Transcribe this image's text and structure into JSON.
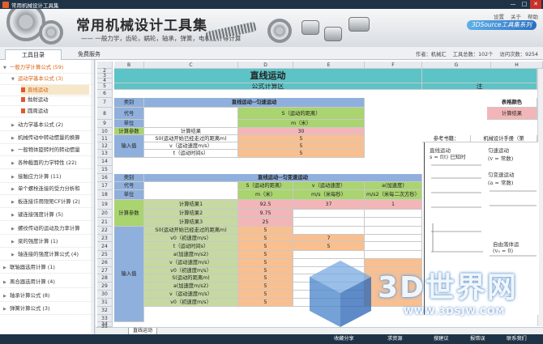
{
  "window": {
    "title": "常用机械设计工具集",
    "minimize": "—",
    "maximize": "□",
    "close": "✕"
  },
  "banner": {
    "title": "常用机械设计工具集",
    "subtitle": "—— 一般力学，齿轮，蜗轮，轴承，弹簧，电机设计等计算",
    "brand": "3DSource工具集系列",
    "top_actions": [
      "设置",
      "关于",
      "帮助"
    ]
  },
  "tabs": [
    {
      "label": "工具目录",
      "active": true
    },
    {
      "label": "免费服务",
      "active": false
    }
  ],
  "stats": {
    "author": "作者：机械汇",
    "total": "工具总数：102个",
    "visits": "访问次数：9254"
  },
  "sidebar": {
    "items": [
      {
        "label": "一般力学计算公式 (59)",
        "level": 0,
        "expanded": true,
        "orange": true
      },
      {
        "label": "运动学基本公式 (3)",
        "level": 1,
        "expanded": true,
        "orange": true
      },
      {
        "label": "直线运动",
        "level": 2,
        "doc": true,
        "selected": true,
        "orange": true
      },
      {
        "label": "抛射运动",
        "level": 2,
        "doc": true
      },
      {
        "label": "圆周运动",
        "level": 2,
        "doc": true
      },
      {
        "label": "动力学基本公式 (2)",
        "level": 1
      },
      {
        "label": "机械传动中转动惯量的换算",
        "level": 1
      },
      {
        "label": "一般物体旋转时的转动惯量",
        "level": 1
      },
      {
        "label": "各种截面的力学特性 (22)",
        "level": 1
      },
      {
        "label": "接触应力计算 (11)",
        "level": 1
      },
      {
        "label": "单个螺栓连接的受力分析和",
        "level": 1
      },
      {
        "label": "板连接许用限矩CF计算 (2)",
        "level": 1
      },
      {
        "label": "键连接强度计算 (5)",
        "level": 1
      },
      {
        "label": "螺纹传动的运动及力率计算",
        "level": 1
      },
      {
        "label": "梁的强度计算 (1)",
        "level": 1
      },
      {
        "label": "轴连接的强度计算公式 (4)",
        "level": 1
      },
      {
        "label": "联轴器选用计算 (1)",
        "level": 0
      },
      {
        "label": "离合器选用计算 (4)",
        "level": 0
      },
      {
        "label": "轴承计算公式 (8)",
        "level": 0
      },
      {
        "label": "弹簧计算公式 (3)",
        "level": 0
      }
    ]
  },
  "sheet": {
    "columns": [
      "B",
      "C",
      "D",
      "E",
      "F",
      "G",
      "H",
      "I"
    ],
    "rows": [
      "2",
      "3",
      "4",
      "5",
      "6",
      "7",
      "8",
      "9",
      "10",
      "11",
      "12",
      "13",
      "14",
      "15",
      "16",
      "17",
      "18",
      "19",
      "20",
      "21",
      "22",
      "23",
      "24",
      "25",
      "26",
      "27",
      "28",
      "29",
      "30",
      "31",
      "32",
      "33",
      "34",
      "35"
    ],
    "main_title": "直线运动",
    "formula_area": "公式计算区",
    "note_area": "注",
    "uniform": {
      "title": "直线运动--匀速运动",
      "category": "类别",
      "code": "代号",
      "unit": "单位",
      "s_label": "S（运动的距离）",
      "s_unit": "m（米）",
      "calc_param": "计算参数",
      "calc_result": "计算结果",
      "result_value": "30",
      "input_value": "输入值",
      "rows": [
        {
          "label": "S0(运动开始已经走过的距离m)",
          "value": "5"
        },
        {
          "label": "v（运动速度m/s）",
          "value": "5"
        },
        {
          "label": "t（运动时间s）",
          "value": "5"
        }
      ]
    },
    "variable": {
      "title": "直线运动--匀变速运动",
      "category": "类别",
      "code": "代号",
      "unit": "单位",
      "col_s": "S（运动的距离）",
      "col_v": "v（运动速度）",
      "col_a": "a(加速度)",
      "unit_s": "m（米）",
      "unit_v": "m/s（米每秒）",
      "unit_a": "m/s2（米每二次方秒）",
      "calc_param": "计算参数",
      "results": [
        {
          "label": "计算结果1",
          "s": "92.5",
          "v": "37",
          "a": "1"
        },
        {
          "label": "计算结果2",
          "s": "9.75",
          "v": "",
          "a": ""
        },
        {
          "label": "计算结果3",
          "s": "25",
          "v": "",
          "a": ""
        }
      ],
      "input_value": "输入值",
      "inputs": [
        {
          "label": "S0(运动开始已经走过的距离m)",
          "d": "5",
          "e": ""
        },
        {
          "label": "v0（初速度m/s）",
          "d": "5",
          "e": "7"
        },
        {
          "label": "t（运动时间s）",
          "d": "5",
          "e": "5"
        },
        {
          "label": "a(加速度m/s2)",
          "d": "5",
          "e": ""
        },
        {
          "label": "v（运动速度m/s）",
          "d": "5",
          "e": ""
        },
        {
          "label": "v0（初速度m/s）",
          "d": "5",
          "e": ""
        },
        {
          "label": "S(运动的距离m)",
          "d": "5",
          "e": ""
        },
        {
          "label": "a(加速度m/s2)",
          "d": "5",
          "e": ""
        },
        {
          "label": "v（运动速度m/s）",
          "d": "5",
          "e": ""
        },
        {
          "label": "v0（初速度m/s）",
          "d": "5",
          "e": ""
        }
      ]
    },
    "notes": {
      "header": "表格颜色",
      "calc_result_tag": "计算结果",
      "ref": "参考书籍：",
      "ref_value": "机械设计手册（第",
      "lines": [
        "直线运动",
        "s = f(t) 已知时",
        "匀速运动",
        "(v = 常数)",
        "匀变速运动",
        "(a = 常数)",
        "自由落体运",
        "(v₀ = 0)"
      ]
    },
    "sheet_tab": "直线运动"
  },
  "statusbar": {
    "buttons": [
      "收藏分享",
      "求资源",
      "搜建议",
      "报错误",
      "联系我们"
    ]
  },
  "watermark": {
    "text": "3D世界网",
    "url": "WWW.3DSJW.COM"
  },
  "colors": {
    "teal": "#5cc3c6",
    "blue": "#8fb0dc",
    "green": "#a9d46f",
    "orange": "#f9bf8f",
    "pink": "#f2b6b8",
    "accent": "#d8620f"
  }
}
